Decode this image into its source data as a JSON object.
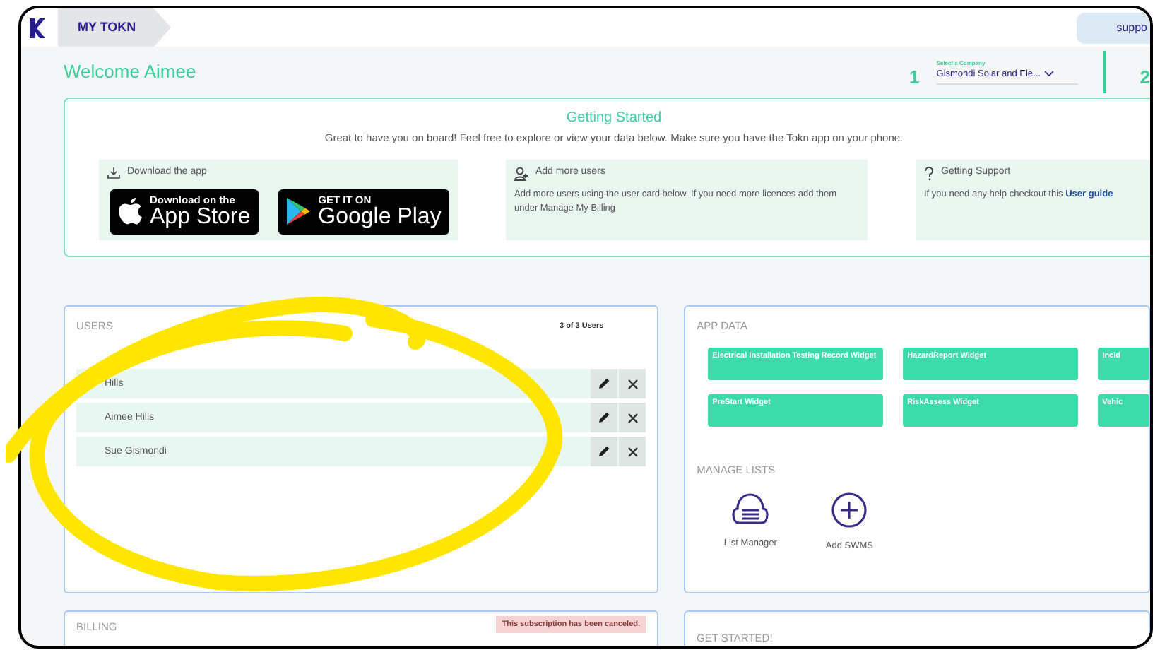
{
  "header": {
    "tab": "MY TOKN",
    "support": "suppo"
  },
  "welcome": "Welcome Aimee",
  "company": {
    "step": "1",
    "label": "Select a Company",
    "value": "Gismondi Solar and Ele...",
    "next_step": "2"
  },
  "getting_started": {
    "title": "Getting Started",
    "subtitle": "Great to have you on board! Feel free to explore or view your data below. Make sure you have the Tokn app on your phone.",
    "cards": [
      {
        "kind": "download",
        "title": "Download the app",
        "badges": [
          {
            "kind": "apple",
            "small": "Download on the",
            "big": "App Store"
          },
          {
            "kind": "google",
            "small": "GET IT ON",
            "big": "Google Play"
          }
        ]
      },
      {
        "kind": "users",
        "title": "Add more users",
        "text": "Add more users using the user card below. If you need more licences add them under Manage My Billing"
      },
      {
        "kind": "support",
        "title": "Getting Support",
        "text": "If you need any help checkout this",
        "link": "User guide"
      }
    ]
  },
  "users": {
    "title": "USERS",
    "count": "3 of 3 Users",
    "rows": [
      {
        "name": "Hills"
      },
      {
        "name": "Aimee Hills"
      },
      {
        "name": "Sue Gismondi"
      }
    ]
  },
  "app_data": {
    "title": "APP DATA",
    "widgets": [
      {
        "label": "Electrical Installation Testing Record Widget"
      },
      {
        "label": "HazardReport Widget"
      },
      {
        "label": "Incid"
      },
      {
        "label": "PreStart Widget"
      },
      {
        "label": "RiskAssess Widget"
      },
      {
        "label": "Vehic"
      }
    ],
    "manage_title": "MANAGE LISTS",
    "lists": [
      {
        "kind": "list",
        "label": "List Manager"
      },
      {
        "kind": "add",
        "label": "Add SWMS"
      }
    ]
  },
  "billing": {
    "title": "BILLING",
    "alert": "This subscription has been canceled."
  },
  "get_started": {
    "title": "GET STARTED!"
  }
}
